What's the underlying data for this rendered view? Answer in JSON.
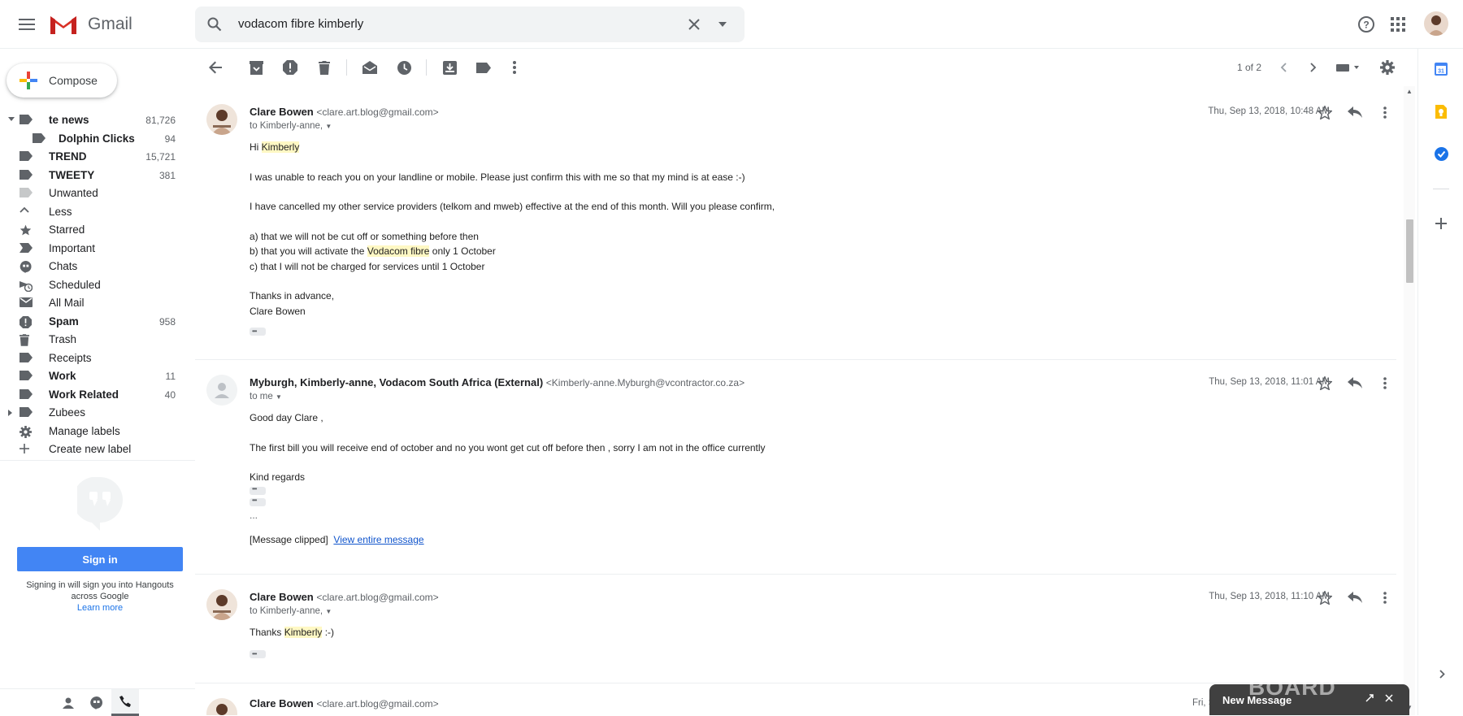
{
  "app": {
    "name": "Gmail"
  },
  "search": {
    "query": "vodacom fibre kimberly"
  },
  "compose": {
    "label": "Compose"
  },
  "labels": [
    {
      "name": "te news",
      "count": "81,726",
      "bold": true,
      "icon": "label-icon"
    },
    {
      "name": "Dolphin Clicks",
      "count": "94",
      "bold": true,
      "icon": "label-icon"
    },
    {
      "name": "TREND",
      "count": "15,721",
      "bold": true,
      "icon": "label-icon"
    },
    {
      "name": "TWEETY",
      "count": "381",
      "bold": true,
      "icon": "label-icon"
    },
    {
      "name": "Unwanted",
      "count": "",
      "bold": false,
      "icon": "label-icon"
    },
    {
      "name": "Less",
      "count": "",
      "bold": false,
      "icon": "chevron-up-icon"
    },
    {
      "name": "Starred",
      "count": "",
      "bold": false,
      "icon": "star-icon"
    },
    {
      "name": "Important",
      "count": "",
      "bold": false,
      "icon": "important-icon"
    },
    {
      "name": "Chats",
      "count": "",
      "bold": false,
      "icon": "chat-icon"
    },
    {
      "name": "Scheduled",
      "count": "",
      "bold": false,
      "icon": "scheduled-icon"
    },
    {
      "name": "All Mail",
      "count": "",
      "bold": false,
      "icon": "mail-icon"
    },
    {
      "name": "Spam",
      "count": "958",
      "bold": true,
      "icon": "spam-icon"
    },
    {
      "name": "Trash",
      "count": "",
      "bold": false,
      "icon": "trash-icon"
    },
    {
      "name": "Receipts",
      "count": "",
      "bold": false,
      "icon": "label-icon"
    },
    {
      "name": "Work",
      "count": "11",
      "bold": true,
      "icon": "label-icon"
    },
    {
      "name": "Work Related",
      "count": "40",
      "bold": true,
      "icon": "label-icon"
    },
    {
      "name": "Zubees",
      "count": "",
      "bold": false,
      "icon": "label-icon"
    },
    {
      "name": "Manage labels",
      "count": "",
      "bold": false,
      "icon": "gear-icon"
    },
    {
      "name": "Create new label",
      "count": "",
      "bold": false,
      "icon": "plus-icon"
    }
  ],
  "hangouts": {
    "sign_in": "Sign in",
    "line1": "Signing in will sign you into Hangouts",
    "line2": "across Google",
    "learn_more": "Learn more"
  },
  "toolbar": {
    "pagination": "1 of 2"
  },
  "messages": [
    {
      "sender": "Clare Bowen",
      "email": "<clare.art.blog@gmail.com>",
      "to": "to Kimberly-anne,",
      "date": "Thu, Sep 13, 2018, 10:48 AM",
      "greeting_pre": "Hi ",
      "greeting_hl": "Kimberly",
      "p1": "I was unable to reach you on your landline or mobile. Please just confirm this with me so that my mind is at ease :-)",
      "p2": "I have cancelled my other service providers (telkom and mweb) effective at the end of this month. Will you please confirm,",
      "a": "a) that we will not be cut off or something before then",
      "b_pre": "b) that you will activate the ",
      "b_hl": "Vodacom fibre",
      "b_post": " only 1 October",
      "c": "c) that I will not be charged for services until 1 October",
      "thanks": "Thanks in advance,",
      "sig": "Clare Bowen"
    },
    {
      "sender": "Myburgh, Kimberly-anne, Vodacom South Africa (External)",
      "email": "<Kimberly-anne.Myburgh@vcontractor.co.za>",
      "to": "to me",
      "date": "Thu, Sep 13, 2018, 11:01 AM",
      "greeting": "Good day Clare ,",
      "p1": "The first bill you will receive end of october and no you wont get cut off before then , sorry I am not in the office currently",
      "regards": "Kind regards",
      "ellipsis": "...",
      "clipped": "[Message clipped]",
      "view_entire": "View entire message"
    },
    {
      "sender": "Clare Bowen",
      "email": "<clare.art.blog@gmail.com>",
      "to": "to Kimberly-anne,",
      "date": "Thu, Sep 13, 2018, 11:10 AM",
      "thanks_pre": "Thanks ",
      "thanks_hl": "Kimberly",
      "thanks_post": " :-)"
    },
    {
      "sender": "Clare Bowen",
      "email": "<clare.art.blog@gmail.com>",
      "date": "Fri, S"
    }
  ],
  "new_message": {
    "title": "New Message"
  },
  "watermark": "BOARD",
  "colors": {
    "accent_blue": "#4285f4",
    "gmail_red": "#d93025",
    "highlight": "#fff8c4"
  }
}
